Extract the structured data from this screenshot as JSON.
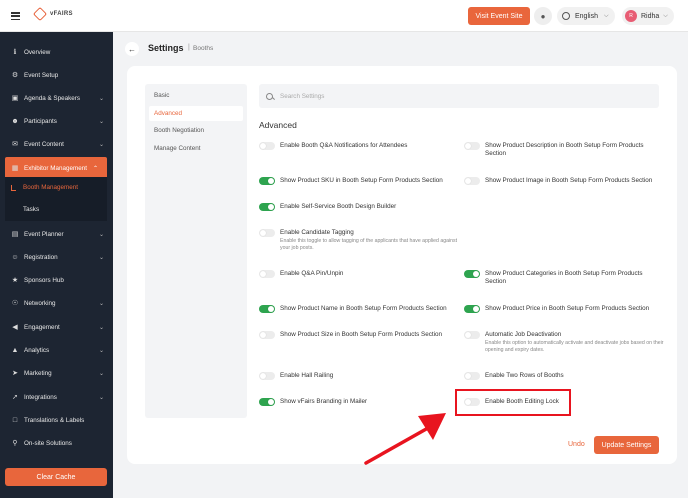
{
  "topbar": {
    "logo_text": "vFAIRS",
    "visit_button": "Visit Event Site",
    "language": "English",
    "user_initial": "R",
    "user_name": "Ridha"
  },
  "sidebar": {
    "items": [
      {
        "label": "Overview",
        "icon": "info-icon"
      },
      {
        "label": "Event Setup",
        "icon": "gear-icon"
      },
      {
        "label": "Agenda & Speakers",
        "icon": "calendar-icon"
      },
      {
        "label": "Participants",
        "icon": "people-icon"
      },
      {
        "label": "Event Content",
        "icon": "mail-icon"
      },
      {
        "label": "Exhibitor Management",
        "icon": "booth-icon"
      },
      {
        "label": "Event Planner",
        "icon": "planner-icon"
      },
      {
        "label": "Registration",
        "icon": "user-plus-icon"
      },
      {
        "label": "Sponsors Hub",
        "icon": "sponsors-icon"
      },
      {
        "label": "Networking",
        "icon": "network-icon"
      },
      {
        "label": "Engagement",
        "icon": "megaphone-icon"
      },
      {
        "label": "Analytics",
        "icon": "chart-icon"
      },
      {
        "label": "Marketing",
        "icon": "send-icon"
      },
      {
        "label": "Integrations",
        "icon": "rocket-icon"
      },
      {
        "label": "Translations & Labels",
        "icon": "translate-icon"
      },
      {
        "label": "On-site Solutions",
        "icon": "pin-icon"
      }
    ],
    "sub_items": [
      "Booth Management",
      "Tasks"
    ],
    "clear_cache": "Clear Cache"
  },
  "header": {
    "title": "Settings",
    "separator": "|",
    "breadcrumb": "Booths"
  },
  "tabs": [
    "Basic",
    "Advanced",
    "Booth Negotiation",
    "Manage Content"
  ],
  "search": {
    "placeholder": "Search Settings"
  },
  "section_title": "Advanced",
  "settings_left": [
    {
      "label": "Enable Booth Q&A Notifications for Attendees",
      "on": false
    },
    {
      "label": "Show Product SKU in Booth Setup Form Products Section",
      "on": true
    },
    {
      "label": "Enable Self-Service Booth Design Builder",
      "on": true
    },
    {
      "label": "Enable Candidate Tagging",
      "desc": "Enable this toggle to allow tagging of the applicants that have applied against your job posts.",
      "on": false
    },
    {
      "label": "Enable Q&A Pin/Unpin",
      "on": false
    },
    {
      "label": "Show Product Name in Booth Setup Form Products Section",
      "on": true
    },
    {
      "label": "Show Product Size in Booth Setup Form Products Section",
      "on": false
    },
    {
      "label": "Enable Hall Railing",
      "on": false
    },
    {
      "label": "Show vFairs Branding in Mailer",
      "on": true
    }
  ],
  "settings_right": [
    {
      "label": "Show Product Description in Booth Setup Form Products Section",
      "on": false
    },
    {
      "label": "Show Product Image in Booth Setup Form Products Section",
      "on": false
    },
    {
      "label": "Show Product Categories in Booth Setup Form Products Section",
      "on": true
    },
    {
      "label": "Show Product Price in Booth Setup Form Products Section",
      "on": true
    },
    {
      "label": "Automatic Job Deactivation",
      "desc": "Enable this option to automatically activate and deactivate jobs based on their opening and expiry dates.",
      "on": false
    },
    {
      "label": "Enable Two Rows of Booths",
      "on": false
    },
    {
      "label": "Enable Booth Editing Lock",
      "on": false
    }
  ],
  "footer": {
    "undo": "Undo",
    "update": "Update Settings"
  },
  "colors": {
    "accent": "#e8663c",
    "sidebar_bg": "#1d2532",
    "toggle_on": "#2ea44f",
    "annotation_red": "#e8141f"
  }
}
